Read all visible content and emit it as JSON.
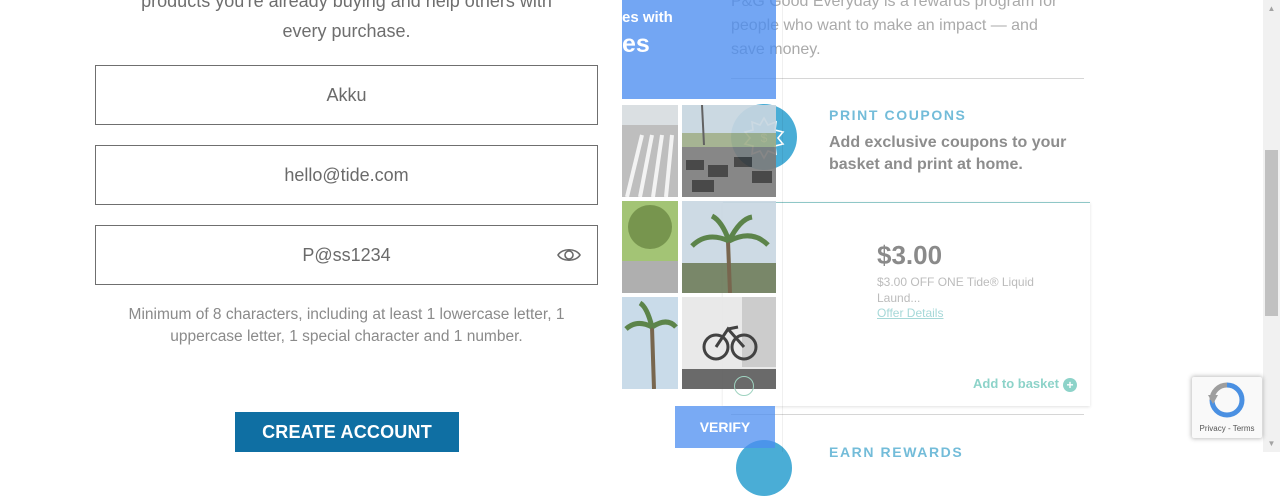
{
  "intro": {
    "line1": "products you're already buying and help others with",
    "line2": "every purchase."
  },
  "form": {
    "name_value": "Akku",
    "email_value": "hello@tide.com",
    "password_value": "P@ss1234",
    "password_hint": "Minimum of 8 characters, including at least 1 lowercase letter, 1 uppercase letter, 1 special character and 1 number.",
    "create_label": "CREATE ACCOUNT"
  },
  "captcha": {
    "header_line1": "es with",
    "header_line2": "es",
    "verify_label": "VERIFY",
    "tiles": [
      "crosswalk",
      "parking-lot",
      "street-trees",
      "palm-tree",
      "palm-tree",
      "bicycle"
    ]
  },
  "program": {
    "description": "P&G Good Everyday is a rewards program for people who want to make an impact — and save money.",
    "print_coupons": {
      "title": "PRINT COUPONS",
      "description": "Add exclusive coupons to your basket and print at home."
    },
    "offer": {
      "price": "$3.00",
      "text": "$3.00 OFF ONE Tide® Liquid Laund...",
      "details_label": "Offer Details",
      "add_label": "Add to basket"
    },
    "earn_rewards": {
      "title": "EARN REWARDS"
    }
  },
  "recaptcha": {
    "privacy": "Privacy",
    "terms": "Terms",
    "sep": " - "
  },
  "colors": {
    "primary_button": "#0f6fa3",
    "captcha_blue": "#4c8df0",
    "accent_teal": "#8dd3c9"
  }
}
